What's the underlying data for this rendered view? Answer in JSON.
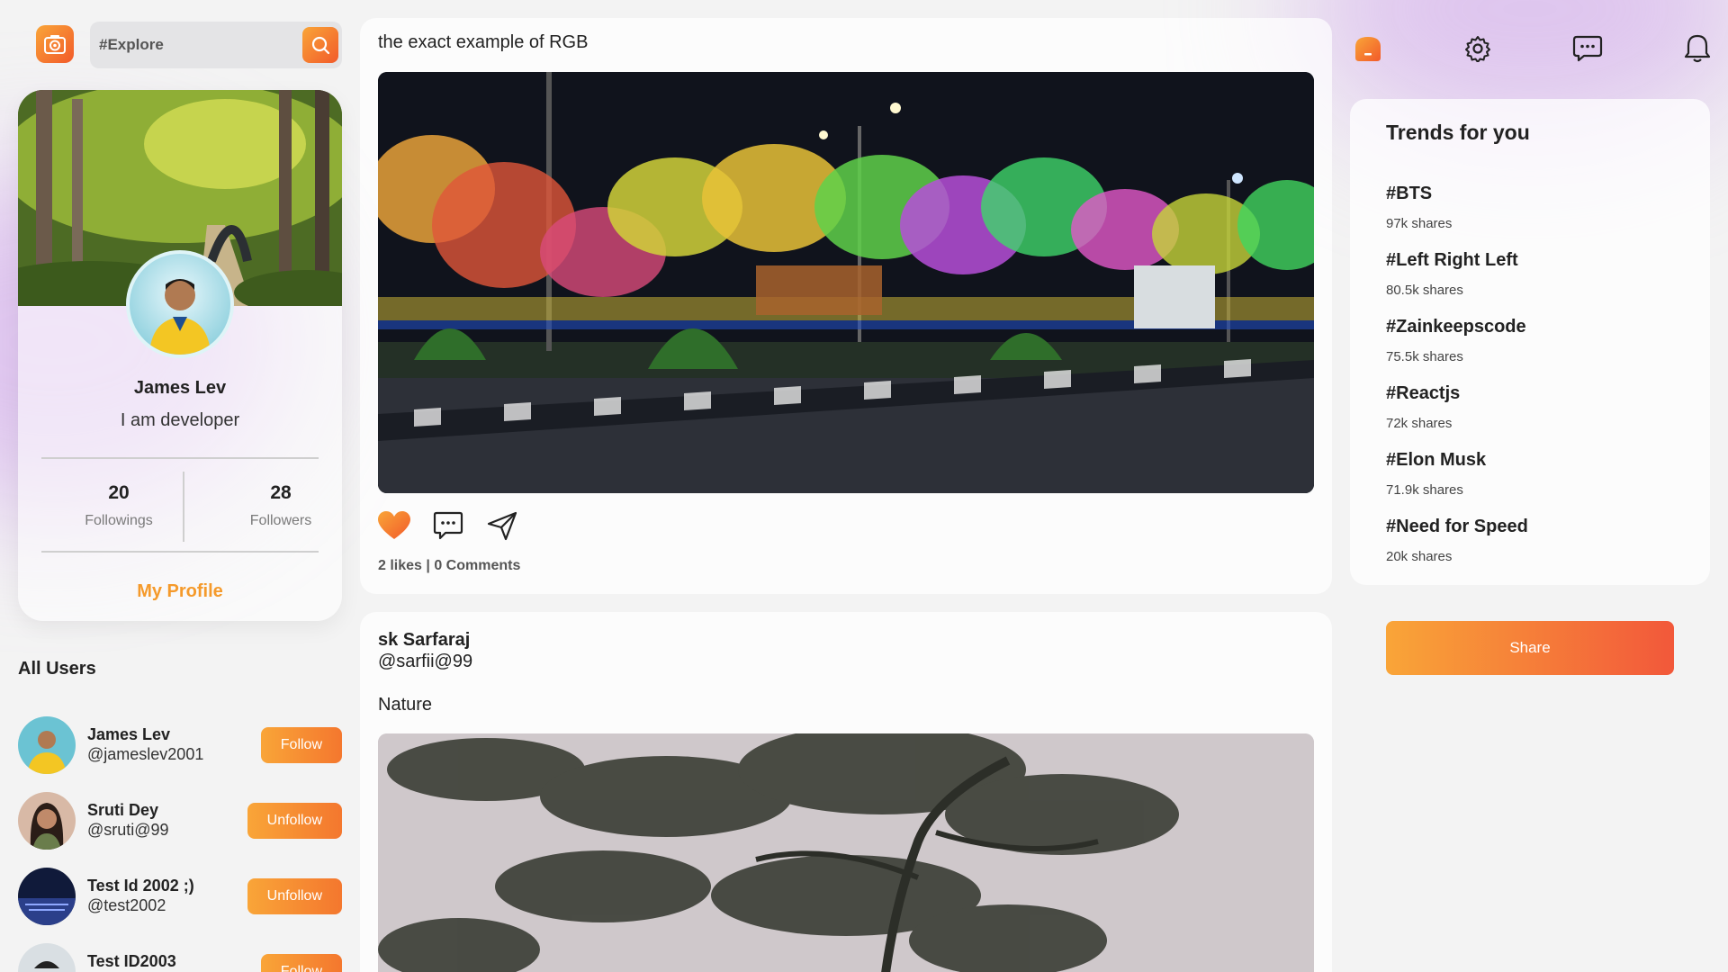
{
  "search": {
    "placeholder": "#Explore"
  },
  "profile": {
    "name": "James Lev",
    "bio": "I am developer",
    "followings_count": "20",
    "followings_label": "Followings",
    "followers_count": "28",
    "followers_label": "Followers",
    "link_label": "My Profile"
  },
  "all_users": {
    "title": "All Users",
    "users": [
      {
        "name": "James Lev",
        "handle": "@jameslev2001",
        "action": "Follow"
      },
      {
        "name": "Sruti Dey",
        "handle": "@sruti@99",
        "action": "Unfollow"
      },
      {
        "name": "Test Id 2002 ;)",
        "handle": "@test2002",
        "action": "Unfollow"
      },
      {
        "name": "Test ID2003",
        "handle": "",
        "action": "Follow"
      }
    ]
  },
  "posts": [
    {
      "caption": "the exact example of RGB",
      "likes": "2 likes",
      "separator": "|",
      "comments": "0 Comments"
    },
    {
      "author_name": "sk Sarfaraj",
      "author_handle": "@sarfii@99",
      "caption": "Nature"
    }
  ],
  "nav": {
    "icons": [
      "home-icon",
      "gear-icon",
      "chat-icon",
      "bell-icon"
    ]
  },
  "trends": {
    "title": "Trends for you",
    "items": [
      {
        "tag": "#BTS",
        "shares": "97k shares"
      },
      {
        "tag": "#Left Right Left",
        "shares": "80.5k shares"
      },
      {
        "tag": "#Zainkeepscode",
        "shares": "75.5k shares"
      },
      {
        "tag": "#Reactjs",
        "shares": "72k shares"
      },
      {
        "tag": "#Elon Musk",
        "shares": "71.9k shares"
      },
      {
        "tag": "#Need for Speed",
        "shares": "20k shares"
      }
    ]
  },
  "share_button": "Share",
  "colors": {
    "accent_start": "#f9a538",
    "accent_end": "#f25a2a",
    "profile_link": "#f59a2b"
  }
}
